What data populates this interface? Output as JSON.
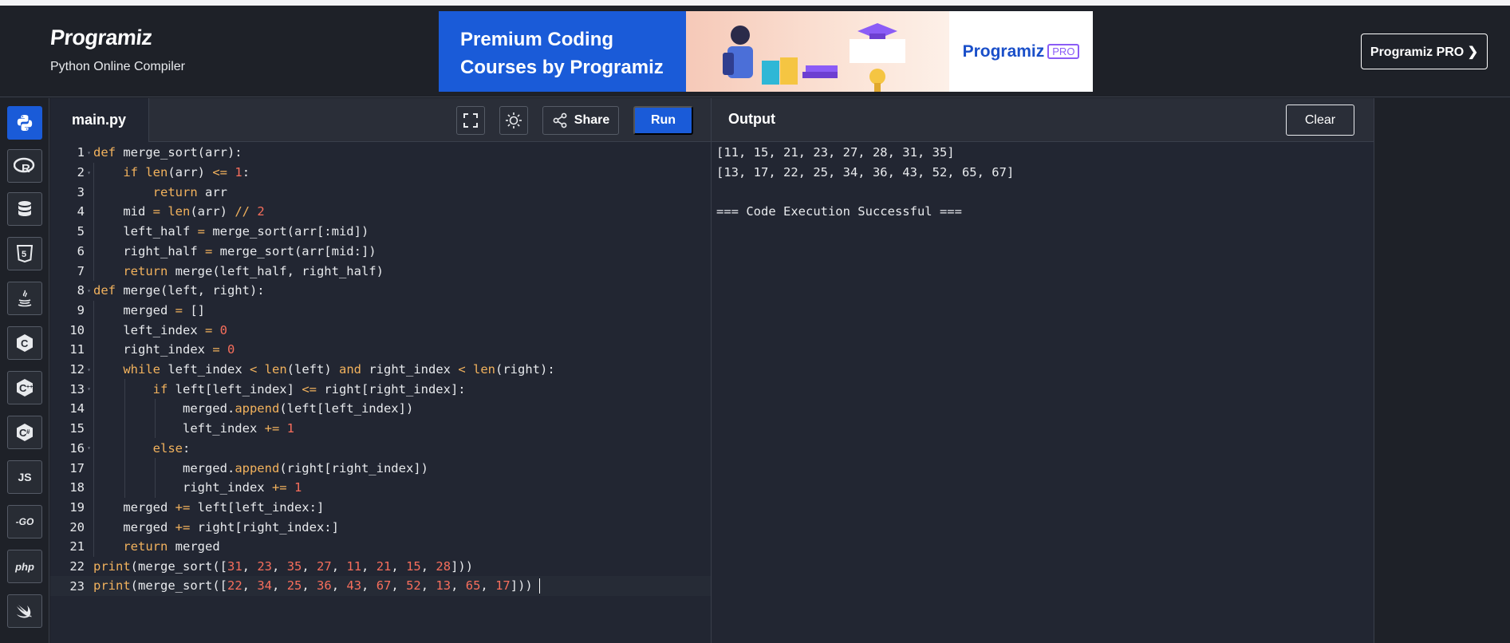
{
  "header": {
    "logo": "Programiz",
    "subtitle": "Python Online Compiler",
    "pro_button": "Programiz PRO ❯"
  },
  "banner": {
    "line1": "Premium Coding",
    "line2": "Courses by Programiz",
    "brand": "Programiz",
    "tag": "PRO"
  },
  "sidebar": {
    "languages": [
      {
        "name": "python",
        "label": "",
        "active": true
      },
      {
        "name": "r",
        "label": "R"
      },
      {
        "name": "sql",
        "label": ""
      },
      {
        "name": "html",
        "label": "5"
      },
      {
        "name": "java",
        "label": ""
      },
      {
        "name": "c",
        "label": "C"
      },
      {
        "name": "cpp",
        "label": "C"
      },
      {
        "name": "csharp",
        "label": "C"
      },
      {
        "name": "js",
        "label": "JS"
      },
      {
        "name": "go",
        "label": "-GO"
      },
      {
        "name": "php",
        "label": "php"
      },
      {
        "name": "swift",
        "label": ""
      }
    ]
  },
  "editor": {
    "file_tab": "main.py",
    "share_label": "Share",
    "run_label": "Run",
    "lines": [
      "def merge_sort(arr):",
      "    if len(arr) <= 1:",
      "        return arr",
      "    mid = len(arr) // 2",
      "    left_half = merge_sort(arr[:mid])",
      "    right_half = merge_sort(arr[mid:])",
      "    return merge(left_half, right_half)",
      "def merge(left, right):",
      "    merged = []",
      "    left_index = 0",
      "    right_index = 0",
      "    while left_index < len(left) and right_index < len(right):",
      "        if left[left_index] <= right[right_index]:",
      "            merged.append(left[left_index])",
      "            left_index += 1",
      "        else:",
      "            merged.append(right[right_index])",
      "            right_index += 1",
      "    merged += left[left_index:]",
      "    merged += right[right_index:]",
      "    return merged",
      "print(merge_sort([31, 23, 35, 27, 11, 21, 15, 28]))",
      "print(merge_sort([22, 34, 25, 36, 43, 67, 52, 13, 65, 17]))"
    ],
    "fold_lines": [
      1,
      2,
      8,
      12,
      13,
      16
    ],
    "current_line": 23
  },
  "output": {
    "title": "Output",
    "clear_label": "Clear",
    "lines": [
      "[11, 15, 21, 23, 27, 28, 31, 35]",
      "[13, 17, 22, 25, 34, 36, 43, 52, 65, 67]",
      "",
      "=== Code Execution Successful ==="
    ]
  },
  "colors": {
    "accent": "#1a5bd8",
    "keyword": "#f2b25d",
    "number": "#f76e5c",
    "background": "#222632"
  }
}
